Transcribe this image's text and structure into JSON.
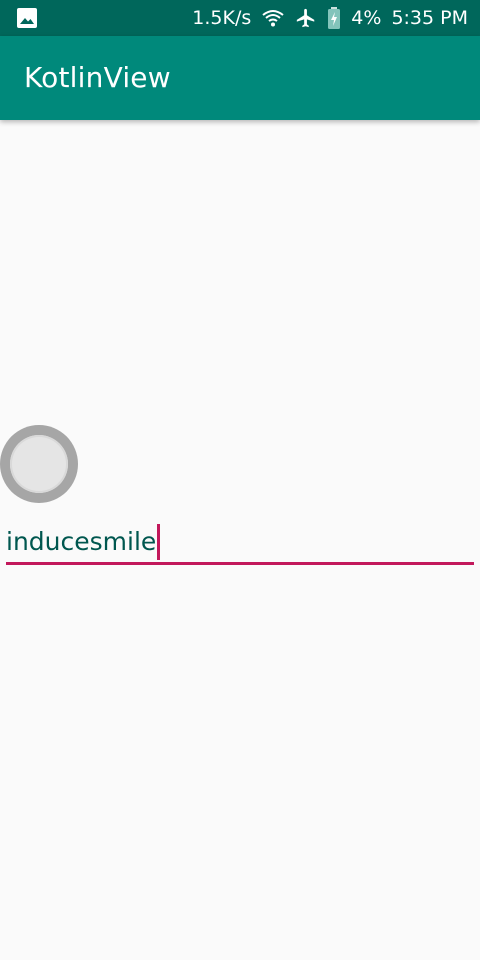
{
  "status_bar": {
    "notification_icon": "image-icon",
    "network_speed": "1.5K/s",
    "wifi_icon": "wifi-icon",
    "airplane_icon": "airplane-icon",
    "battery_icon": "battery-charging-icon",
    "battery_level": "4%",
    "time": "5:35 PM"
  },
  "app_bar": {
    "title": "KotlinView"
  },
  "content": {
    "round_control_icon": "circle-toggle",
    "text_field": {
      "value": "inducesmile"
    }
  },
  "colors": {
    "status_bar": "#00675b",
    "app_bar": "#00897b",
    "accent": "#c2185b",
    "text": "#00574f",
    "background": "#fafafa"
  }
}
